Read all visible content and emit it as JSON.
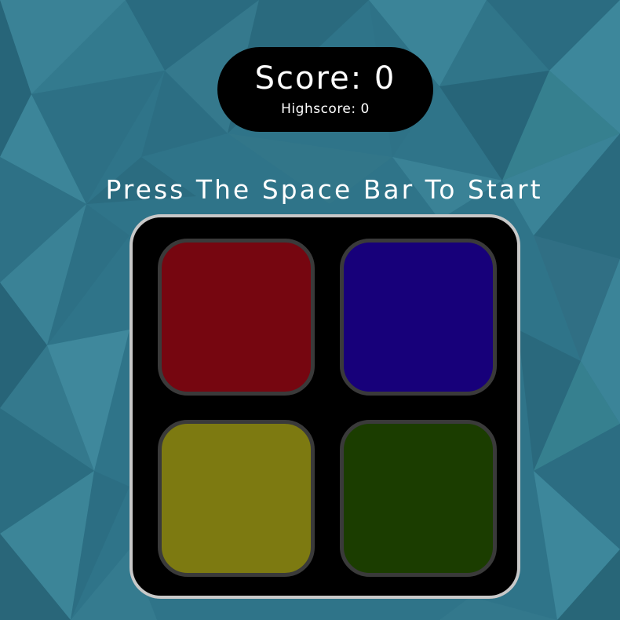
{
  "score": {
    "label": "Score: 0",
    "highscore_label": "Highscore: 0"
  },
  "prompt": "Press The Space Bar To Start",
  "pads": [
    {
      "name": "red-pad",
      "color": "#760610"
    },
    {
      "name": "blue-pad",
      "color": "#17007a"
    },
    {
      "name": "yellow-pad",
      "color": "#7d7a11"
    },
    {
      "name": "green-pad",
      "color": "#1b3d00"
    }
  ],
  "colors": {
    "background": "#2f7489",
    "board": "#000000",
    "board_border": "#c8c8c8",
    "pad_border": "#3a3a3a",
    "text": "#ffffff"
  }
}
